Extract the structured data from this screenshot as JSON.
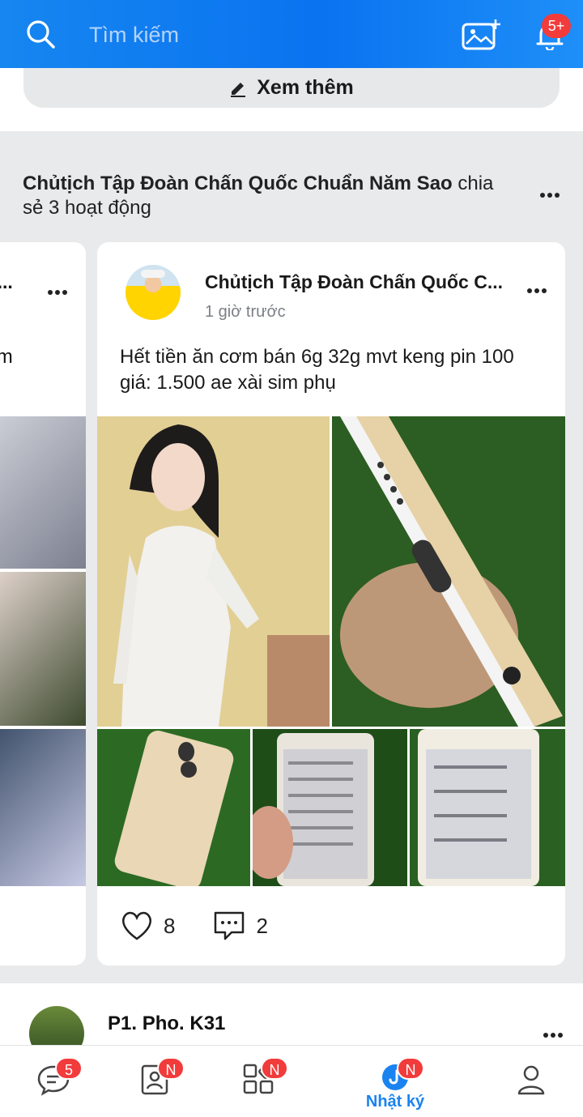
{
  "header": {
    "search_placeholder": "Tìm kiếm",
    "notification_badge": "5+"
  },
  "top": {
    "see_more_label": "Xem thêm"
  },
  "shared": {
    "author": "Chủtịch Tập Đoàn Chấn Quốc Chuẩn Năm Sao",
    "action": " chia sẻ 3 hoạt động"
  },
  "left_card": {
    "author_partial": "C...",
    "text_partial": "ơm"
  },
  "post": {
    "author": "Chủtịch Tập Đoàn Chấn Quốc C...",
    "time": "1 giờ trước",
    "text": "Hết tiền ăn cơm bán 6g 32g mvt keng pin 100 giá: 1.500 ae xài sim phụ",
    "likes": "8",
    "comments": "2"
  },
  "next_post": {
    "author": "P1. Pho. K31"
  },
  "nav": {
    "items": [
      {
        "name": "messages",
        "badge": "5",
        "label": ""
      },
      {
        "name": "contacts",
        "badge": "N",
        "label": ""
      },
      {
        "name": "discover",
        "badge": "N",
        "label": ""
      },
      {
        "name": "diary",
        "badge": "N",
        "label": "Nhật ký"
      },
      {
        "name": "profile",
        "badge": "",
        "label": ""
      }
    ],
    "active_color": "#1a83f0"
  },
  "colors": {
    "header": "#0a73f0",
    "badge": "#f23b3b",
    "accent": "#1a83f0"
  }
}
